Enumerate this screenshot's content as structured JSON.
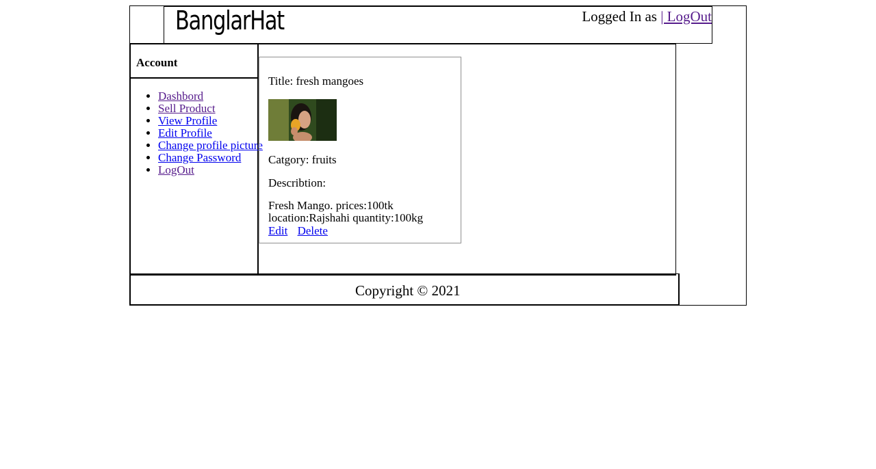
{
  "header": {
    "brand": "BanglarHat",
    "logged_in_text": "Logged In as",
    "logout_link": "| LogOut"
  },
  "sidebar": {
    "title": "Account",
    "items": [
      {
        "label": "Dashbord",
        "visited": true
      },
      {
        "label": "Sell Product",
        "visited": true
      },
      {
        "label": "View Profile",
        "visited": false
      },
      {
        "label": "Edit Profile",
        "visited": false
      },
      {
        "label": "Change profile picture",
        "visited": false
      },
      {
        "label": "Change Password",
        "visited": false
      },
      {
        "label": "LogOut",
        "visited": true
      }
    ]
  },
  "product": {
    "title_line": "Title: fresh mangoes",
    "category_line": "Catgory: fruits",
    "description_label": "Describtion:",
    "description_text": "Fresh Mango. prices:100tk location:Rajshahi quantity:100kg",
    "edit_link": "Edit",
    "delete_link": "Delete"
  },
  "footer": {
    "copyright": "Copyright © 2021"
  }
}
